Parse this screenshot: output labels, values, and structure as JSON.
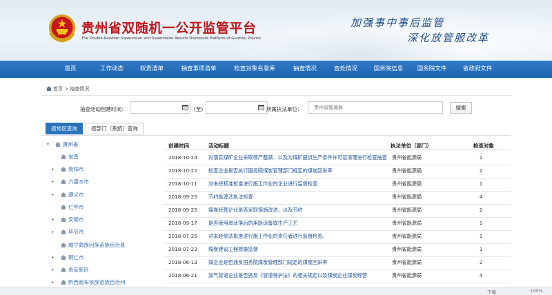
{
  "header": {
    "title": "贵州省双随机一公开监管平台",
    "subtitle": "The Double-Random Supervision and Supervision Results Disclosure Platform of Guizhou Provinc",
    "slogan_line1": "加强事中事后监管",
    "slogan_line2": "深化放管服改革"
  },
  "nav": {
    "items": [
      "首页",
      "工作动态",
      "权责清单",
      "抽查事项清单",
      "检查对象名录库",
      "抽查情况",
      "查处情况",
      "国务院信息",
      "国务院文件",
      "省政府文件"
    ]
  },
  "breadcrumb": {
    "home": "首页",
    "separator": ">",
    "current": "抽查情况"
  },
  "filter": {
    "time_label": "抽查活动创建时间：",
    "to_label": "(至)",
    "unit_label": "所属执法单位：",
    "unit_value": "贵州省能源局",
    "search_button": "搜索"
  },
  "tabs": {
    "by_region": "按地区查询",
    "by_department": "按部门（系统）查询"
  },
  "tree": {
    "items": [
      {
        "label": "贵州省",
        "level": 0,
        "arrow": true
      },
      {
        "label": "省直",
        "level": 1,
        "arrow": false
      },
      {
        "label": "贵阳市",
        "level": 1,
        "arrow": true
      },
      {
        "label": "六盘水市",
        "level": 1,
        "arrow": true
      },
      {
        "label": "遵义市",
        "level": 1,
        "arrow": true
      },
      {
        "label": "仁怀市",
        "level": 1,
        "arrow": false
      },
      {
        "label": "安顺市",
        "level": 1,
        "arrow": true
      },
      {
        "label": "毕节市",
        "level": 1,
        "arrow": true
      },
      {
        "label": "威宁彝族回族苗族自治县",
        "level": 1,
        "arrow": false
      },
      {
        "label": "铜仁市",
        "level": 1,
        "arrow": true
      },
      {
        "label": "贵安新区",
        "level": 1,
        "arrow": true
      },
      {
        "label": "黔西南布依族苗族自治州",
        "level": 1,
        "arrow": true
      }
    ]
  },
  "table": {
    "headers": {
      "date": "创建时间",
      "title": "活动标题",
      "unit": "执法单位（部门）",
      "count": "检查对象"
    },
    "rows": [
      {
        "date": "2018-10-24",
        "title": "对落实煤矿企业采取停产整顿、以及为煤矿提供生产条件许可证清理进行检查抽查",
        "unit": "贵州省能源局",
        "count": "1"
      },
      {
        "date": "2018-10-22",
        "title": "检查企业是否执行国务院煤炭管理部门规定的煤炭回采率",
        "unit": "贵州省能源局",
        "count": "2"
      },
      {
        "date": "2018-10-11",
        "title": "对未经核准批准进行施工作业的企业进行监督检查",
        "unit": "贵州省能源局",
        "count": "1"
      },
      {
        "date": "2018-09-25",
        "title": "节约能源法执法检查",
        "unit": "贵州省能源局",
        "count": "4"
      },
      {
        "date": "2018-09-25",
        "title": "煤炭经营企业是否采取措施改进，以及节约",
        "unit": "贵州省能源局",
        "count": "2"
      },
      {
        "date": "2018-09-17",
        "title": "是否使用淘汰落后的用能设备或生产工艺",
        "unit": "贵州省能源局",
        "count": "1"
      },
      {
        "date": "2018-07-25",
        "title": "对未经依法批准进行施工作业的责任者进行监督检查。",
        "unit": "贵州省能源局",
        "count": "1"
      },
      {
        "date": "2018-07-23",
        "title": "煤炭建设工程质量监督",
        "unit": "贵州省能源局",
        "count": "1"
      },
      {
        "date": "2018-06-13",
        "title": "煤企业是否违反国务院煤炭管理部门规定的煤炭回采率",
        "unit": "贵州省能源局",
        "count": "2"
      },
      {
        "date": "2018-06-21",
        "title": "加气管道企业是否违反《管道保护法》的相关规定以及煤炭企业煤炭经营",
        "unit": "贵州省能源局",
        "count": "4"
      }
    ]
  },
  "status": {
    "left": "",
    "right1": "下载",
    "right2": "100%"
  },
  "colors": {
    "title_red": "#c2161c",
    "nav_blue": "#2a73bd",
    "link_blue": "#1d4f94"
  }
}
